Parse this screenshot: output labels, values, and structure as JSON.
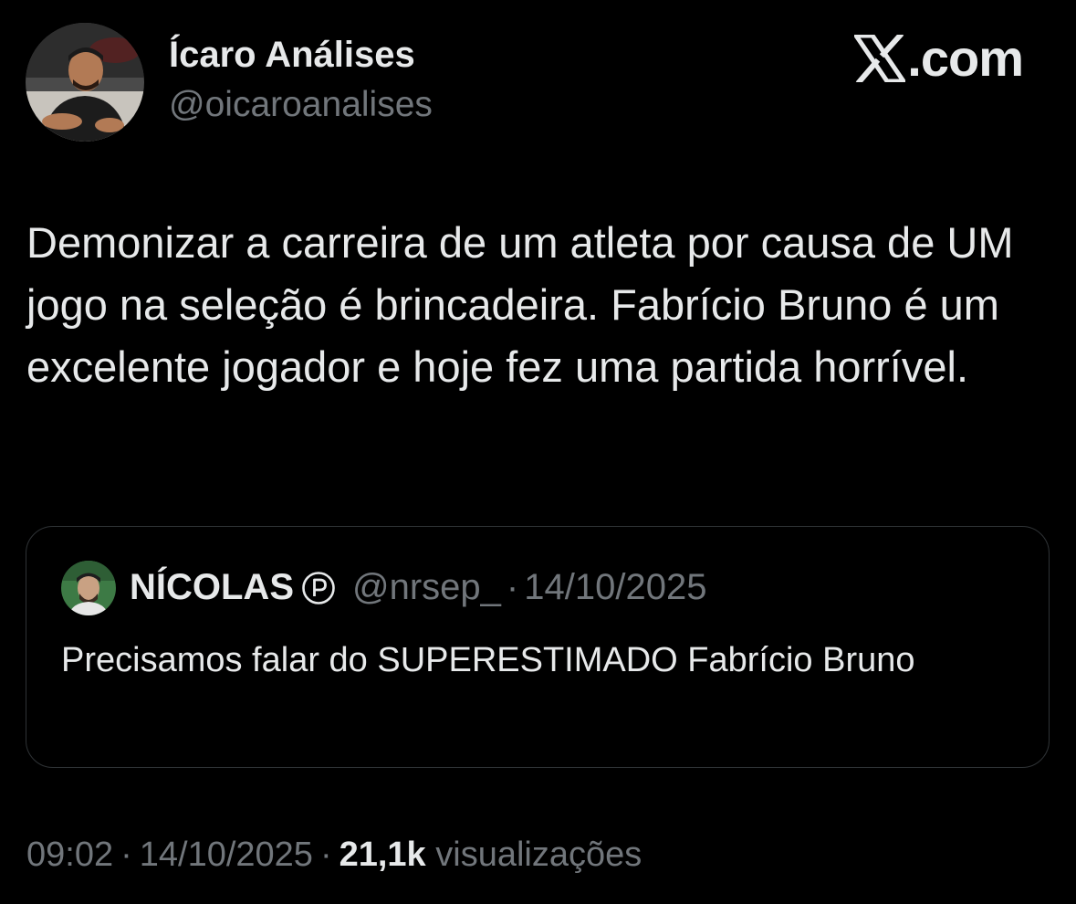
{
  "author": {
    "display_name": "Ícaro Análises",
    "handle": "@oicaroanalises"
  },
  "brand": {
    "icon": "x-logo-icon",
    "domain": ".com"
  },
  "tweet": {
    "text": "Demonizar a carreira de um atleta por causa de UM jogo na seleção é brincadeira. Fabrício Bruno é um excelente jogador e hoje fez uma partida horrível."
  },
  "quote": {
    "display_name": "NÍCOLAS",
    "badge_icon": "parody-badge-icon",
    "handle": "@nrsep_",
    "separator": "·",
    "date": "14/10/2025",
    "text": "Precisamos falar do SUPERESTIMADO Fabrício Bruno"
  },
  "footer": {
    "time": "09:02",
    "separator": "·",
    "date": "14/10/2025",
    "views_count": "21,1k",
    "views_label": "visualizações"
  },
  "colors": {
    "background": "#000000",
    "text_primary": "#e7e9ea",
    "text_secondary": "#71767b",
    "card_border": "#2f3336"
  }
}
